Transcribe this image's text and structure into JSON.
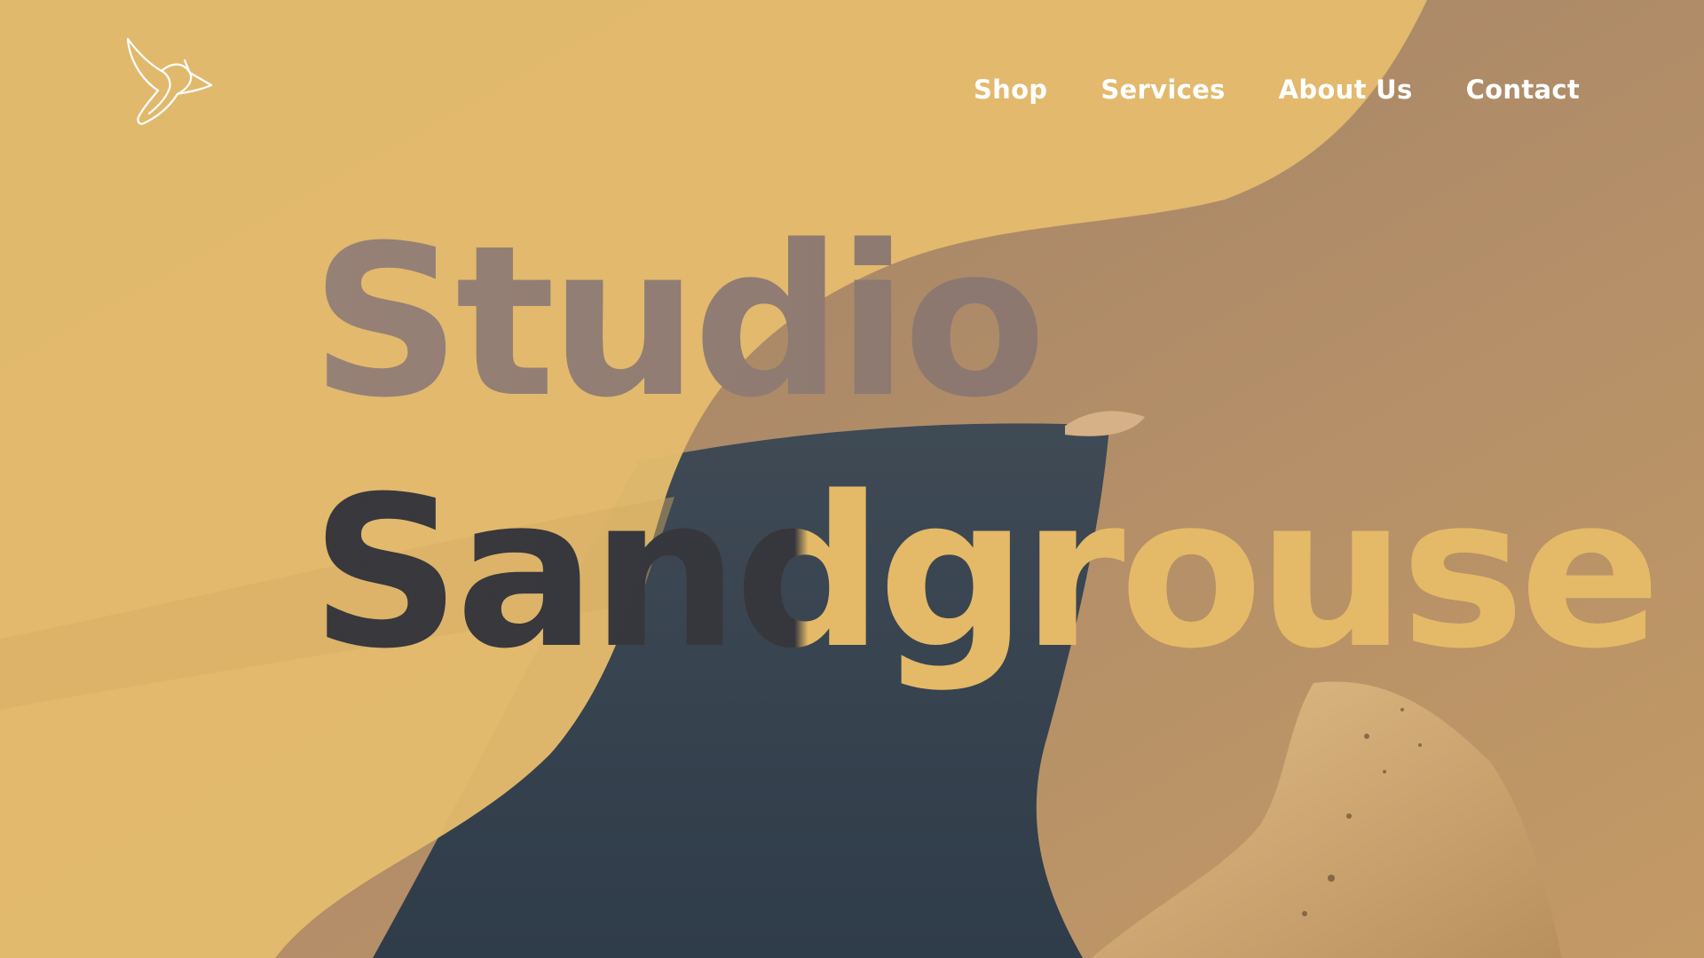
{
  "brand": {
    "logo_icon": "hummingbird-icon",
    "title_line1": "Studio",
    "title_line2": "Sandgrouse"
  },
  "nav": {
    "items": [
      {
        "label": "Shop"
      },
      {
        "label": "Services"
      },
      {
        "label": "About Us"
      },
      {
        "label": "Contact"
      }
    ]
  },
  "colors": {
    "accent_yellow": "#e4bb6d",
    "nav_text": "#ffffff"
  }
}
